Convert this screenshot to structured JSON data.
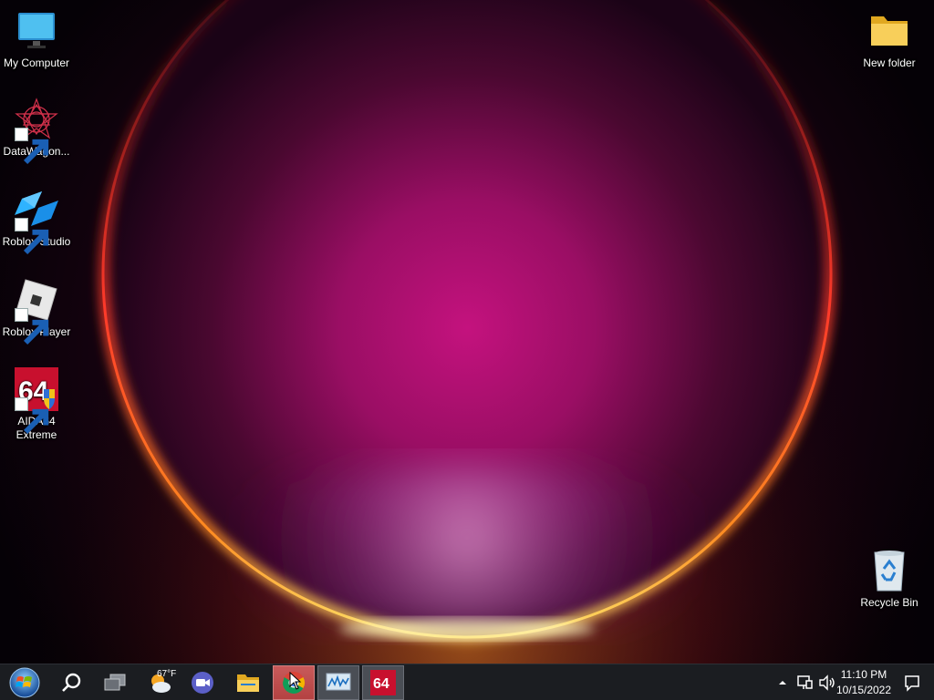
{
  "desktop": {
    "left_icons": [
      {
        "name": "my-computer",
        "label": "My Computer",
        "icon": "monitor-icon",
        "shortcut": false
      },
      {
        "name": "datawagon",
        "label": "DataWagon...",
        "icon": "datawagon-icon",
        "shortcut": true
      },
      {
        "name": "roblox-studio",
        "label": "Roblox Studio",
        "icon": "roblox-studio-icon",
        "shortcut": true
      },
      {
        "name": "roblox-player",
        "label": "Roblox Player",
        "icon": "roblox-player-icon",
        "shortcut": true
      },
      {
        "name": "aida64",
        "label": "AIDA64 Extreme",
        "icon": "aida64-icon",
        "shortcut": true
      }
    ],
    "right_icons": [
      {
        "name": "new-folder",
        "label": "New folder",
        "icon": "folder-icon"
      },
      {
        "name": "recycle-bin",
        "label": "Recycle Bin",
        "icon": "recycle-bin-icon"
      }
    ]
  },
  "taskbar": {
    "start_icon": "windows-start-icon",
    "weather_temp": "67°F",
    "pinned": [
      {
        "name": "search",
        "icon": "search-icon"
      },
      {
        "name": "task-view",
        "icon": "task-view-icon"
      },
      {
        "name": "weather",
        "icon": "weather-icon"
      },
      {
        "name": "meet",
        "icon": "video-chat-icon"
      },
      {
        "name": "file-explorer",
        "icon": "file-explorer-icon"
      },
      {
        "name": "chrome",
        "icon": "chrome-icon",
        "active": true
      },
      {
        "name": "resource-monitor",
        "icon": "monitor-graph-icon",
        "active": true
      },
      {
        "name": "aida64-task",
        "icon": "aida64-icon",
        "active": true
      }
    ],
    "aida_text": "64",
    "tray": {
      "icons": [
        "chevron-up-icon",
        "network-icon",
        "volume-icon"
      ],
      "time": "11:10 PM",
      "date": "10/15/2022",
      "notification_icon": "notification-icon"
    }
  },
  "colors": {
    "taskbar": "#1b1d21",
    "glow_center": "#c4127e",
    "rim_orange": "#ff7a1a",
    "rim_yellow": "#ffe066"
  }
}
